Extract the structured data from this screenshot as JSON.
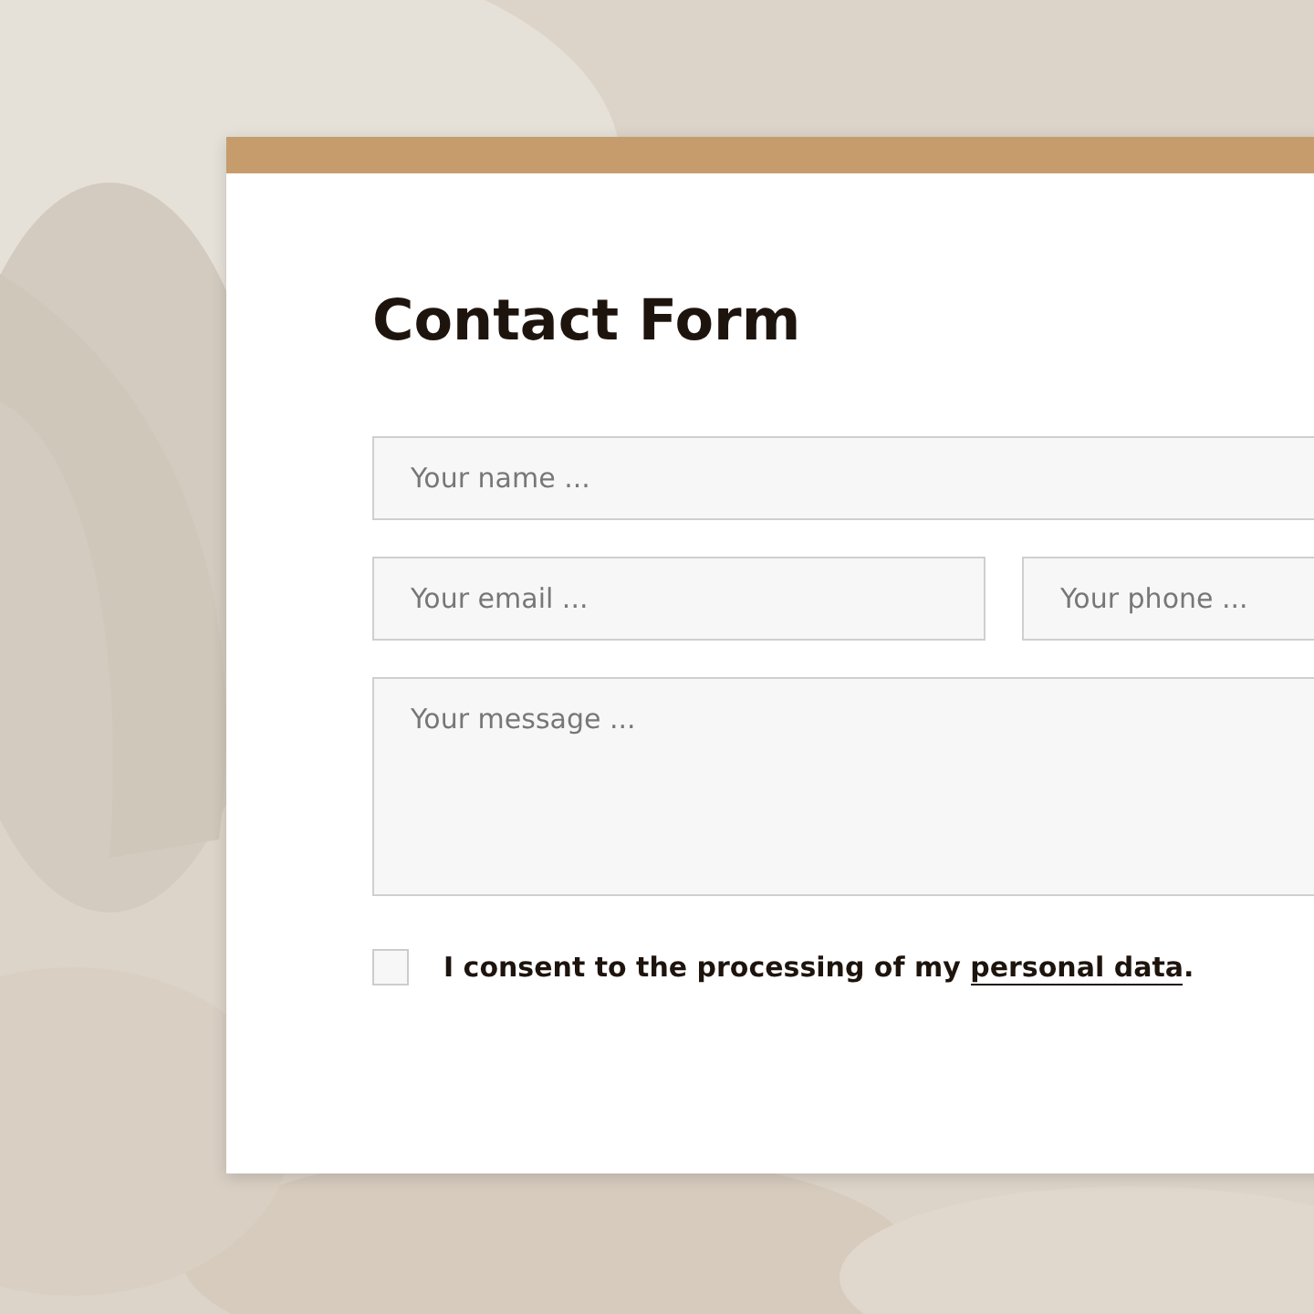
{
  "form": {
    "title": "Contact Form",
    "fields": [
      {
        "kind": "wide",
        "placeholder": "Your name ..."
      },
      {
        "kind": "half",
        "placeholder": "Your email ..."
      },
      {
        "kind": "half",
        "placeholder": "Your phone ..."
      },
      {
        "kind": "area",
        "placeholder": "Your message ..."
      }
    ],
    "consent": {
      "checked": false,
      "text_before": "I consent to the processing of my ",
      "link": "personal data",
      "text_after": "."
    }
  }
}
